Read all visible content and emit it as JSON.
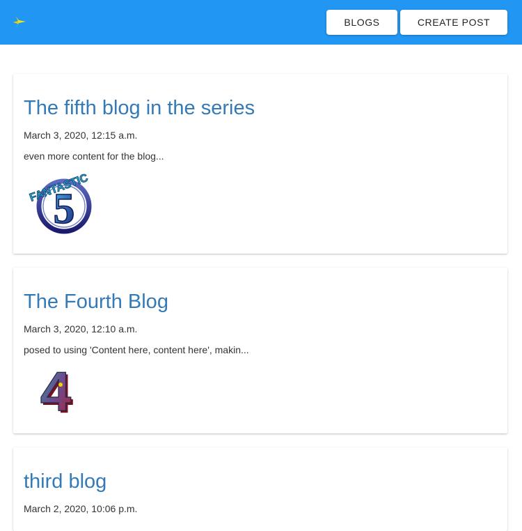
{
  "header": {
    "logo_icon": "plane-icon",
    "nav": {
      "blogs_label": "BLOGS",
      "create_post_label": "CREATE POST"
    },
    "colors": {
      "appbar": "#2196f3",
      "logo": "#ffeb3b"
    }
  },
  "posts": [
    {
      "title": "The fifth blog in the series",
      "date": "March 3, 2020, 12:15 a.m.",
      "excerpt": "even more content for the blog...",
      "image_text": "FANTASTIC",
      "image_number": "5"
    },
    {
      "title": "The Fourth Blog",
      "date": "March 3, 2020, 12:10 a.m.",
      "excerpt": "posed to using 'Content here, content here', makin...",
      "image_number": "4"
    },
    {
      "title": "third blog",
      "date": "March 2, 2020, 10:06 p.m."
    }
  ],
  "colors": {
    "link": "#337ab7",
    "text": "#333333"
  }
}
